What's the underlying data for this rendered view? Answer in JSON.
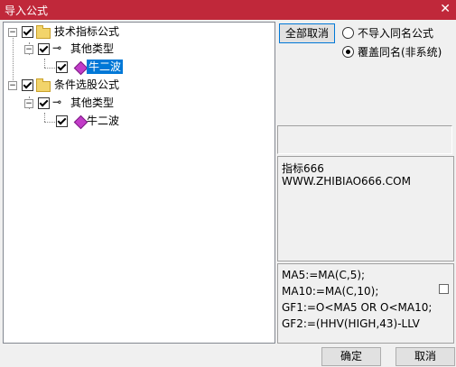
{
  "window": {
    "title": "导入公式",
    "close_glyph": "✕"
  },
  "tree": {
    "nodes": [
      {
        "label": "技术指标公式"
      },
      {
        "label": "其他类型"
      },
      {
        "label": "牛二波"
      },
      {
        "label": "条件选股公式"
      },
      {
        "label": "其他类型"
      },
      {
        "label": "牛二波"
      }
    ],
    "expander_glyph": "−"
  },
  "buttons": {
    "deselect_all": "全部取消",
    "ok": "确定",
    "cancel": "取消"
  },
  "options": {
    "no_import_same": "不导入同名公式",
    "overwrite_same": "覆盖同名(非系统)",
    "selected": "overwrite_same"
  },
  "info": {
    "line1": "指标666",
    "line2": "WWW.ZHIBIAO666.COM"
  },
  "code": {
    "lines": [
      "MA5:=MA(C,5);",
      "MA10:=MA(C,10);",
      "GF1:=O<MA5 OR O<MA10;",
      "GF2:=(HHV(HIGH,43)-LLV"
    ]
  }
}
